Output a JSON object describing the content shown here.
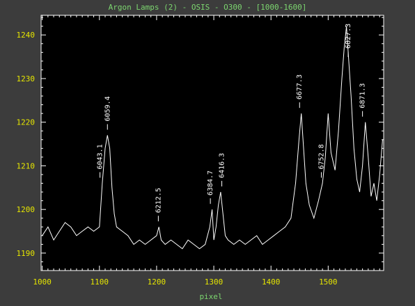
{
  "window": {
    "title": "Argon Lamps (2) - OSIS - O300 - [1000-1600]"
  },
  "colors": {
    "background": "#3c3c3c",
    "plot_background": "#000000",
    "frame": "#ffffff",
    "tick_labels": "#e6e600",
    "title_text": "#7cd66f",
    "trace": "#ffffff"
  },
  "chart_data": {
    "type": "line",
    "title": "Argon Lamps (2) - OSIS - O300 - [1000-1600]",
    "xlabel": "pixel",
    "ylabel": "",
    "xlim": [
      998,
      1597
    ],
    "ylim": [
      1186,
      1244.5
    ],
    "grid": false,
    "x_ticks": [
      1000,
      1100,
      1200,
      1300,
      1400,
      1500
    ],
    "y_ticks": [
      1190,
      1200,
      1210,
      1220,
      1230,
      1240
    ],
    "x_tick_labels": [
      "1000",
      "1100",
      "1200",
      "1300",
      "1400",
      "1500"
    ],
    "y_tick_labels": [
      "1190",
      "1200",
      "1210",
      "1220",
      "1230",
      "1240"
    ],
    "series": [
      {
        "x": [
          1000,
          1010,
          1020,
          1030,
          1040,
          1050,
          1060,
          1070,
          1080,
          1090,
          1100,
          1105,
          1110,
          1114,
          1118,
          1122,
          1126,
          1130,
          1140,
          1150,
          1160,
          1170,
          1180,
          1190,
          1200,
          1204,
          1208,
          1215,
          1225,
          1235,
          1245,
          1255,
          1265,
          1275,
          1285,
          1293,
          1297,
          1300,
          1304,
          1308,
          1312,
          1316,
          1320,
          1325,
          1335,
          1345,
          1355,
          1365,
          1375,
          1385,
          1395,
          1405,
          1415,
          1425,
          1435,
          1443,
          1449,
          1453,
          1457,
          1461,
          1467,
          1475,
          1483,
          1490,
          1495,
          1500,
          1505,
          1512,
          1518,
          1524,
          1528,
          1532,
          1536,
          1540,
          1545,
          1550,
          1555,
          1560,
          1565,
          1570,
          1575,
          1580,
          1585,
          1590,
          1595
        ],
        "y": [
          1194,
          1196,
          1193,
          1195,
          1197,
          1196,
          1194,
          1195,
          1196,
          1195,
          1196,
          1206,
          1214,
          1217,
          1214,
          1205,
          1199,
          1196,
          1195,
          1194,
          1192,
          1193,
          1192,
          1193,
          1194,
          1196,
          1193,
          1192,
          1193,
          1192,
          1191,
          1193,
          1192,
          1191,
          1192,
          1196,
          1200,
          1193,
          1196,
          1201,
          1204,
          1199,
          1194,
          1193,
          1192,
          1193,
          1192,
          1193,
          1194,
          1192,
          1193,
          1194,
          1195,
          1196,
          1198,
          1206,
          1216,
          1222,
          1214,
          1206,
          1201,
          1198,
          1202,
          1206,
          1212,
          1222,
          1213,
          1209,
          1218,
          1230,
          1237,
          1242,
          1234,
          1226,
          1214,
          1207,
          1204,
          1210,
          1220,
          1212,
          1203,
          1206,
          1202,
          1208,
          1216
        ]
      }
    ],
    "annotations": [
      {
        "label": "6043.1",
        "x": 1101
      },
      {
        "label": "6059.4",
        "x": 1114
      },
      {
        "label": "6212.5",
        "x": 1203
      },
      {
        "label": "6384.7",
        "x": 1294
      },
      {
        "label": "6416.3",
        "x": 1314
      },
      {
        "label": "6677.3",
        "x": 1450
      },
      {
        "label": "6752.8",
        "x": 1488
      },
      {
        "label": "6827.3",
        "x": 1535
      },
      {
        "label": "6871.3",
        "x": 1560
      }
    ]
  }
}
